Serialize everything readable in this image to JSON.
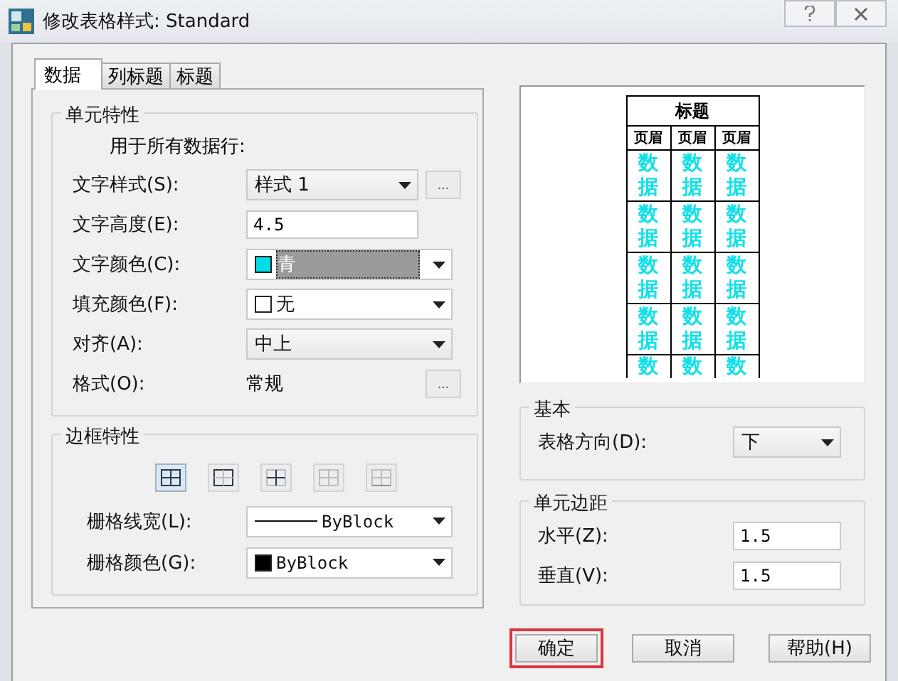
{
  "window": {
    "title": "修改表格样式: Standard"
  },
  "tabs": [
    {
      "label": "数据",
      "selected": true
    },
    {
      "label": "列标题",
      "selected": false
    },
    {
      "label": "标题",
      "selected": false
    }
  ],
  "cell_properties": {
    "title": "单元特性",
    "note": "用于所有数据行:",
    "rows": [
      {
        "kind": "combo",
        "label": "文字样式(S):",
        "value": "样式 1",
        "more": "..."
      },
      {
        "kind": "text",
        "label": "文字高度(E):",
        "value": "4.5"
      },
      {
        "kind": "color",
        "label": "文字颜色(C):",
        "value": "青",
        "color": "#00dde6",
        "highlighted": true
      },
      {
        "kind": "color",
        "label": "填充颜色(F):",
        "value": "无",
        "color": "#ffffff",
        "highlighted": false
      },
      {
        "kind": "combo",
        "label": "对齐(A):",
        "value": "中上"
      },
      {
        "kind": "static",
        "label": "格式(O):",
        "value": "常规",
        "more": "..."
      }
    ]
  },
  "border_properties": {
    "title": "边框特性",
    "buttons": [
      {
        "kind": "all",
        "selected": true
      },
      {
        "kind": "outside",
        "selected": false
      },
      {
        "kind": "inside",
        "selected": false
      },
      {
        "kind": "none",
        "selected": false
      },
      {
        "kind": "bottom",
        "selected": false
      }
    ],
    "rows": [
      {
        "kind": "lineweight",
        "label": "栅格线宽(L):",
        "value": "ByBlock"
      },
      {
        "kind": "color",
        "label": "栅格颜色(G):",
        "value": "ByBlock",
        "color": "#000000",
        "highlighted": false
      }
    ]
  },
  "preview": {
    "title": "标题",
    "header": [
      "页眉",
      "页眉",
      "页眉"
    ],
    "rows": [
      [
        "数据",
        "数据",
        "数据"
      ],
      [
        "数据",
        "数据",
        "数据"
      ],
      [
        "数据",
        "数据",
        "数据"
      ],
      [
        "数据",
        "数据",
        "数据"
      ],
      [
        "数",
        "数",
        "数"
      ]
    ]
  },
  "general": {
    "title": "基本",
    "rows": [
      {
        "kind": "combo",
        "label": "表格方向(D):",
        "value": "下"
      }
    ]
  },
  "cell_margins": {
    "title": "单元边距",
    "rows": [
      {
        "kind": "text",
        "label": "水平(Z):",
        "value": "1.5"
      },
      {
        "kind": "text",
        "label": "垂直(V):",
        "value": "1.5"
      }
    ]
  },
  "buttons": [
    {
      "label": "确定",
      "highlighted": true
    },
    {
      "label": "取消",
      "highlighted": false
    },
    {
      "label": "帮助(H)",
      "highlighted": false
    }
  ]
}
